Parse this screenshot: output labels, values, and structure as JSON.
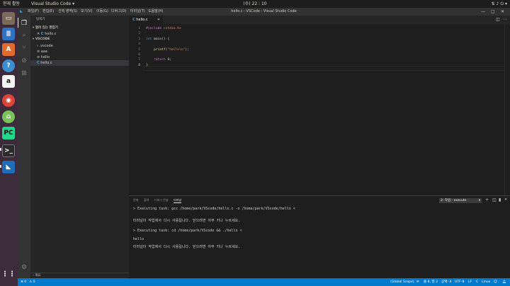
{
  "os": {
    "activities": "현재 활동",
    "app_name": "Visual Studio Code ▾",
    "clock": "(수) 22 : 10"
  },
  "dock": {
    "icons": [
      "files-icon",
      "writer-icon",
      "impress-icon",
      "software-icon",
      "help-icon",
      "amazon-icon",
      "chrome-icon",
      "android-studio-icon",
      "pycharm-icon",
      "terminal-icon",
      "vscode-icon",
      "trash-icon"
    ]
  },
  "window": {
    "title": "hello.c - VSCode - Visual Studio Code",
    "menu": [
      "파일(F)",
      "편집(E)",
      "선택 영역(S)",
      "보기(V)",
      "이동(G)",
      "디버그(D)",
      "터미널(T)",
      "도움말(H)"
    ]
  },
  "sidebar": {
    "header": "탐색기",
    "open_editors": "열려 있는 편집기",
    "open_file": "hello.c",
    "folder": "VSCODE",
    "items": [
      {
        "icon": "›",
        "label": ".vscode"
      },
      {
        "icon": "≡",
        "label": "aaa"
      },
      {
        "icon": "≡",
        "label": "hello"
      },
      {
        "icon": "C",
        "label": "hello.c"
      }
    ],
    "outline": "개요"
  },
  "editor": {
    "tab_label": "hello.c",
    "lines": [
      {
        "n": "1"
      },
      {
        "n": "2"
      },
      {
        "n": "3"
      },
      {
        "n": "4"
      },
      {
        "n": "5"
      },
      {
        "n": "6"
      },
      {
        "n": "7"
      },
      {
        "n": "8"
      }
    ],
    "code": {
      "l1_pp": "#include",
      "l1_inc": "<stdio.h>",
      "l3_kw": "int",
      "l3_rest": " main() {",
      "l5_fn": "printf",
      "l5_open": "(",
      "l5_str": "\"hello\\n\"",
      "l5_close": ");",
      "l7_kw": "return",
      "l7_num": "0",
      "l7_end": ";",
      "l8": "}"
    }
  },
  "panel": {
    "tabs": [
      "문제",
      "출력",
      "디버그 콘솔",
      "터미널"
    ],
    "terminal_select": "2: 작업 - execute",
    "lines": [
      "> Executing task: gcc /home/park/VScode/hello.c -o /home/park/VScode/hello <",
      "터미널이 작업에서 다시 사용됩니다. 닫으려면 아무 키나 누르세요.",
      "> Executing task: cd /home/park/VScode && ./hello <",
      "hello",
      "터미널이 작업에서 다시 사용됩니다. 닫으려면 아무 키나 누르세요."
    ]
  },
  "statusbar": {
    "errors": "⊗ 0",
    "warnings": "⚠ 0",
    "scope": "(Global Scope)",
    "position": "줄 8, 열 2",
    "spaces": "공백: 4",
    "encoding": "UTF-8",
    "eol": "LF",
    "language": "C",
    "os": "Linux",
    "accent": "#007acc"
  }
}
